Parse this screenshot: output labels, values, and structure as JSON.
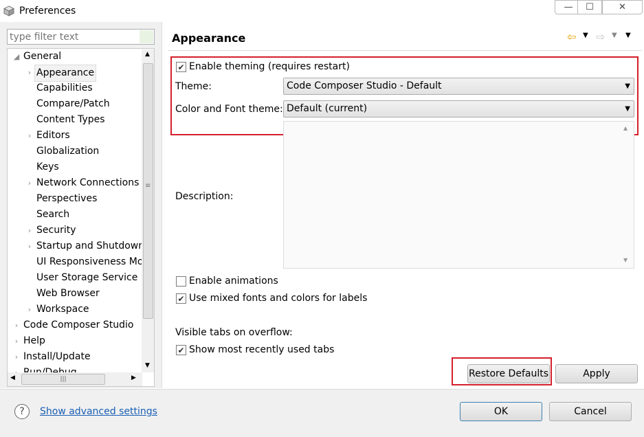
{
  "window": {
    "title": "Preferences",
    "min_glyph": "—",
    "max_glyph": "☐",
    "close_glyph": "✕"
  },
  "filter": {
    "placeholder": "type filter text"
  },
  "tree": {
    "items": [
      {
        "label": "General",
        "expander": "◢",
        "indent": 0
      },
      {
        "label": "Appearance",
        "expander": "›",
        "indent": 1,
        "selected": true
      },
      {
        "label": "Capabilities",
        "expander": "",
        "indent": 1
      },
      {
        "label": "Compare/Patch",
        "expander": "",
        "indent": 1
      },
      {
        "label": "Content Types",
        "expander": "",
        "indent": 1
      },
      {
        "label": "Editors",
        "expander": "›",
        "indent": 1
      },
      {
        "label": "Globalization",
        "expander": "",
        "indent": 1
      },
      {
        "label": "Keys",
        "expander": "",
        "indent": 1
      },
      {
        "label": "Network Connections",
        "expander": "›",
        "indent": 1
      },
      {
        "label": "Perspectives",
        "expander": "",
        "indent": 1
      },
      {
        "label": "Search",
        "expander": "",
        "indent": 1
      },
      {
        "label": "Security",
        "expander": "›",
        "indent": 1
      },
      {
        "label": "Startup and Shutdown",
        "expander": "›",
        "indent": 1
      },
      {
        "label": "UI Responsiveness Mon",
        "expander": "",
        "indent": 1
      },
      {
        "label": "User Storage Service",
        "expander": "",
        "indent": 1
      },
      {
        "label": "Web Browser",
        "expander": "",
        "indent": 1
      },
      {
        "label": "Workspace",
        "expander": "›",
        "indent": 1
      },
      {
        "label": "Code Composer Studio",
        "expander": "›",
        "indent": 0
      },
      {
        "label": "Help",
        "expander": "›",
        "indent": 0
      },
      {
        "label": "Install/Update",
        "expander": "›",
        "indent": 0
      },
      {
        "label": "Run/Debug",
        "expander": "›",
        "indent": 0
      }
    ],
    "hscroll_grip": "|||",
    "vscroll_grip": "≡"
  },
  "page": {
    "title": "Appearance",
    "enable_theming": {
      "label": "Enable theming (requires restart)",
      "checked": true
    },
    "theme": {
      "label": "Theme:",
      "value": "Code Composer Studio - Default"
    },
    "color_font_theme": {
      "label": "Color and Font theme:",
      "value": "Default (current)"
    },
    "description": {
      "label": "Description:"
    },
    "enable_animations": {
      "label": "Enable animations",
      "checked": false
    },
    "mixed_fonts": {
      "label": "Use mixed fonts and colors for labels",
      "checked": true
    },
    "visible_tabs_label": "Visible tabs on overflow:",
    "show_recent_tabs": {
      "label": "Show most recently used tabs",
      "checked": true
    },
    "restore_defaults": "Restore Defaults",
    "apply": "Apply"
  },
  "footer": {
    "help_glyph": "?",
    "advanced_link": "Show advanced settings",
    "ok": "OK",
    "cancel": "Cancel"
  },
  "colors": {
    "highlight_box": "#d41f2b",
    "link": "#1a5fb4",
    "nav_back": "#e8a200"
  }
}
